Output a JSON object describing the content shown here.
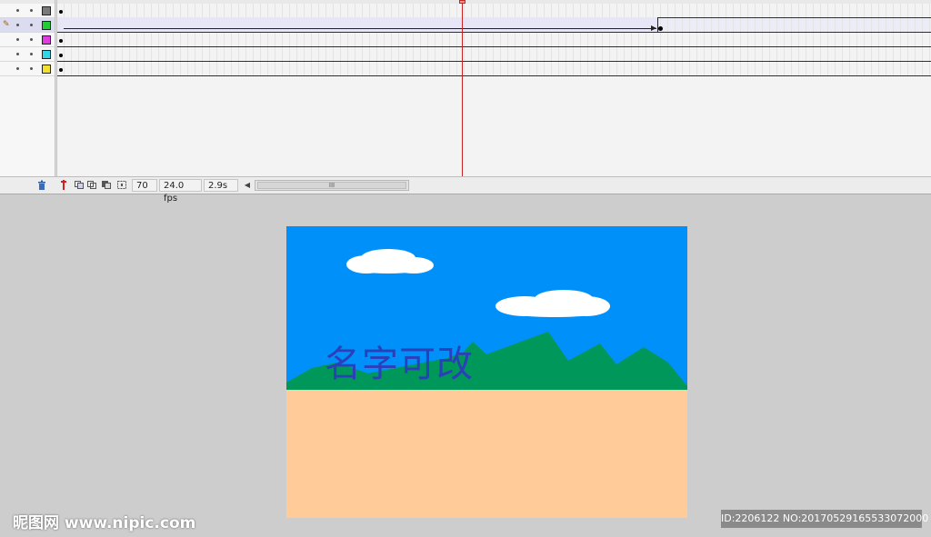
{
  "timeline": {
    "layers": [
      {
        "color": "#7a7a7a",
        "active": false
      },
      {
        "color": "#22cc33",
        "active": true
      },
      {
        "color": "#e03ce0",
        "active": false
      },
      {
        "color": "#33d6e8",
        "active": false
      },
      {
        "color": "#f0e030",
        "active": false
      }
    ],
    "status": {
      "current_frame": "70",
      "frame_rate": "24.0 fps",
      "elapsed_time": "2.9s",
      "scroll_grip": "III",
      "scroll_left_arrow": "◀"
    },
    "colors": {
      "playhead": "#cc2222"
    }
  },
  "stage": {
    "text": "名字可改",
    "colors": {
      "sky": "#0090fa",
      "ground": "#ffcc99",
      "mountains": "#00985a",
      "clouds": "#ffffff",
      "text": "#2a3fb8"
    }
  },
  "watermarks": {
    "logo": "昵图网 www.nipic.com",
    "id_line": "ID:2206122 NO:20170529165533072000"
  }
}
